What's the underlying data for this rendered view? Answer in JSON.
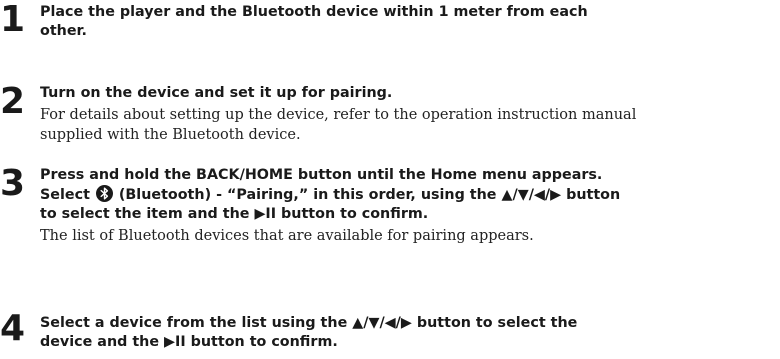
{
  "steps": [
    {
      "number": "1",
      "heading_line1": "Place the player and the Bluetooth device within 1 meter from each",
      "heading_line2": "other."
    },
    {
      "number": "2",
      "heading_line1": "Turn on the device and set it up for pairing.",
      "detail_line1": "For details about setting up the device, refer to the operation instruction manual",
      "detail_line2": "supplied with the Bluetooth device."
    },
    {
      "number": "3",
      "heading_line1": "Press and hold the BACK/HOME button until the Home menu appears.",
      "heading_line2_before_icon": "Select",
      "heading_line2_after_icon": "(Bluetooth) - “Pairing,” in this order, using the ▲/▼/◀/▶ button",
      "heading_line3": "to select the item and the ▶II button to confirm.",
      "detail_line1": "The list of Bluetooth devices that are available for pairing appears.",
      "icon": "bluetooth-icon"
    },
    {
      "number": "4",
      "heading_line1": "Select a device from the list using the ▲/▼/◀/▶ button to select the",
      "heading_line2": "device and the ▶II button to confirm."
    }
  ]
}
